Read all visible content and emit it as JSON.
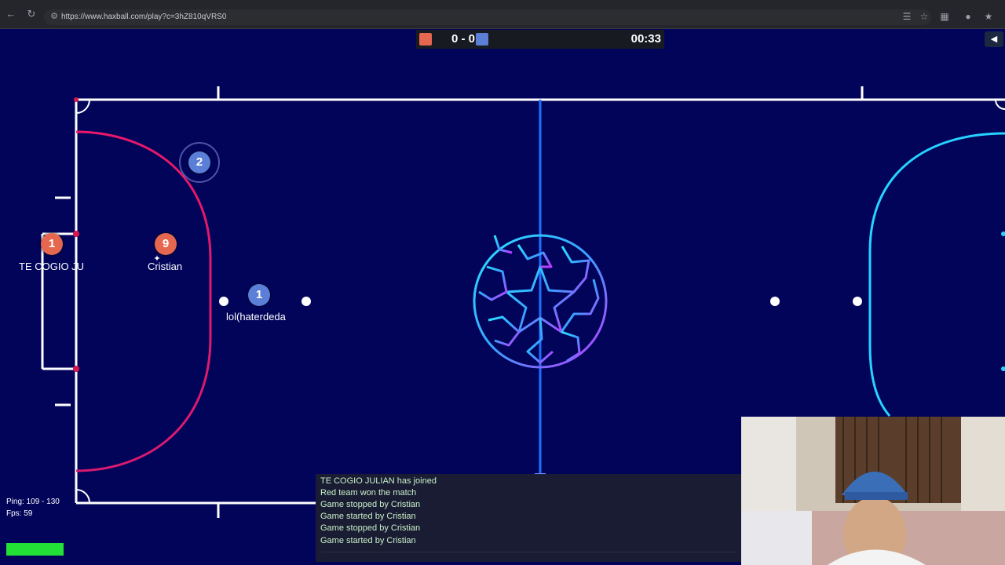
{
  "browser": {
    "url": "https://www.haxball.com/play?c=3hZ810qVRS0"
  },
  "scoreboard": {
    "score": "0 - 0",
    "timer": "00:33",
    "red_color": "#e5674f",
    "blue_color": "#5b7fd6"
  },
  "players": [
    {
      "team": "red",
      "number": "1",
      "name": "TE COGIO JU"
    },
    {
      "team": "red",
      "number": "9",
      "name": "Cristian"
    },
    {
      "team": "blue",
      "number": "2",
      "name": ""
    },
    {
      "team": "blue",
      "number": "1",
      "name": "lol(haterdeda"
    }
  ],
  "stats": {
    "ping": "Ping: 109 - 130",
    "fps": "Fps: 59"
  },
  "chat": {
    "messages": [
      "TE COGIO JULIAN has joined",
      "Red team won the match",
      "Game stopped by Cristian",
      "Game started by Cristian",
      "Game stopped by Cristian",
      "Game started by Cristian"
    ]
  },
  "icons": {
    "back": "back-arrow-icon",
    "forward": "forward-arrow-icon",
    "reload": "reload-icon",
    "lock": "site-info-icon",
    "translate": "translate-icon",
    "bookmark": "star-icon",
    "extensions": "extensions-icon",
    "side-panel": "side-panel-icon",
    "ball": "starball-icon"
  }
}
